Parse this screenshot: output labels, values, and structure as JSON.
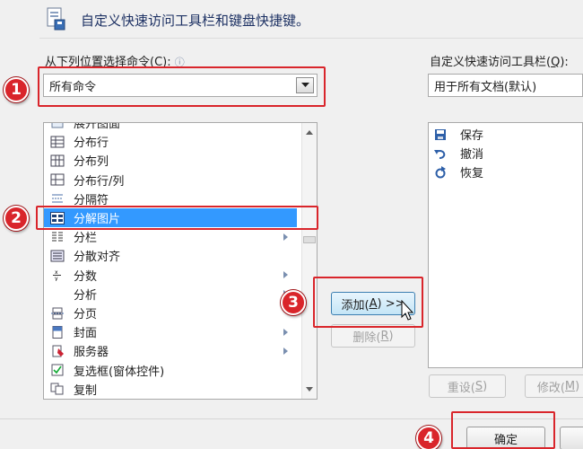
{
  "header": {
    "title": "自定义快速访问工具栏和键盘快捷键。"
  },
  "left": {
    "choose_label_prefix": "从下列位置选择命令(",
    "choose_label_key": "C",
    "choose_label_suffix": "):",
    "info_glyph": "ⓘ",
    "source_value": "所有命令",
    "commands": [
      {
        "label": "展开图面",
        "icon": "expand-icon"
      },
      {
        "label": "分布行",
        "icon": "distribute-rows-icon"
      },
      {
        "label": "分布列",
        "icon": "distribute-columns-icon"
      },
      {
        "label": "分布行/列",
        "icon": "distribute-rows-columns-icon"
      },
      {
        "label": "分隔符",
        "icon": "separator-icon"
      },
      {
        "label": "分解图片",
        "icon": "ungroup-picture-icon",
        "selected": true
      },
      {
        "label": "分栏",
        "icon": "columns-icon",
        "submenu": true
      },
      {
        "label": "分散对齐",
        "icon": "distributed-align-icon"
      },
      {
        "label": "分数",
        "icon": "fraction-icon",
        "submenu": true
      },
      {
        "label": "分析",
        "icon": "",
        "submenu": true
      },
      {
        "label": "分页",
        "icon": "page-break-icon"
      },
      {
        "label": "封面",
        "icon": "cover-page-icon",
        "submenu": true
      },
      {
        "label": "服务器",
        "icon": "server-icon",
        "submenu": true
      },
      {
        "label": "复选框(窗体控件)",
        "icon": "checkbox-icon"
      },
      {
        "label": "复制",
        "icon": "copy-icon"
      }
    ]
  },
  "middle": {
    "add_label": "添加(",
    "add_key": "A",
    "add_suffix": ") >>",
    "remove_label": "删除(",
    "remove_key": "R",
    "remove_suffix": ")"
  },
  "right": {
    "qat_label_prefix": "自定义快速访问工具栏(",
    "qat_label_key": "Q",
    "qat_label_suffix": "):",
    "target_value": "用于所有文档(默认)",
    "items": [
      {
        "label": "保存",
        "icon": "save-icon"
      },
      {
        "label": "撤消",
        "icon": "undo-icon"
      },
      {
        "label": "恢复",
        "icon": "redo-icon"
      }
    ],
    "reset_label": "重设(",
    "reset_key": "S",
    "reset_suffix": ")",
    "modify_label": "修改(",
    "modify_key": "M",
    "modify_suffix": ")"
  },
  "footer": {
    "ok_label": "确定"
  },
  "annotations": [
    "1",
    "2",
    "3",
    "4"
  ],
  "colors": {
    "highlight_red": "#d9252b",
    "selection_blue": "#3399ff",
    "title_blue": "#1e3264"
  }
}
